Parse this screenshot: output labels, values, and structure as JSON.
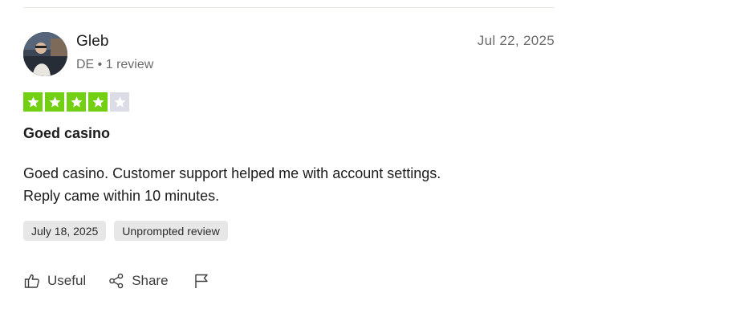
{
  "review": {
    "author": {
      "name": "Gleb",
      "meta": "DE • 1 review"
    },
    "date": "Jul 22, 2025",
    "rating": 4,
    "rating_max": 5,
    "star_icon": "star-icon",
    "title": "Goed casino",
    "body_lines": [
      "Goed casino. Customer support helped me with account settings.",
      "Reply came within 10 minutes."
    ],
    "tags": [
      "July 18, 2025",
      "Unprompted review"
    ]
  },
  "actions": {
    "useful": {
      "label": "Useful",
      "icon": "thumbs-up-icon"
    },
    "share": {
      "label": "Share",
      "icon": "share-icon"
    },
    "report": {
      "icon": "flag-icon"
    }
  },
  "colors": {
    "star_filled": "#73cf11",
    "star_empty": "#dcdce6",
    "tag_bg": "#e7e7e7",
    "muted_text": "#6b6b6b"
  }
}
